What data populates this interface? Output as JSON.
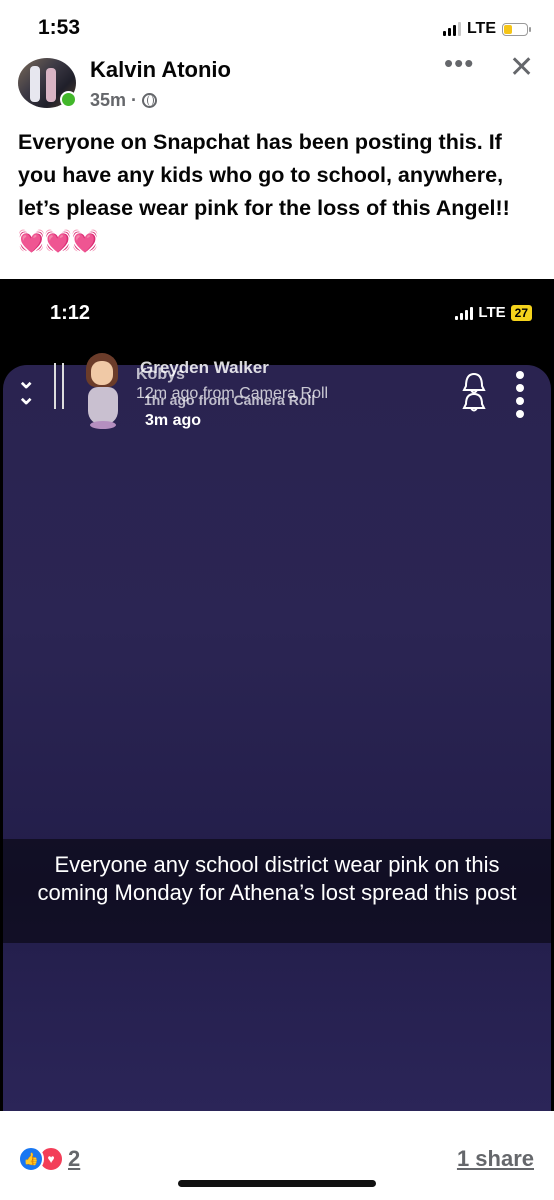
{
  "status_bar": {
    "time": "1:53",
    "network": "LTE",
    "battery_color": "#f5c518"
  },
  "post": {
    "author": "Kalvin Atonio",
    "time_ago": "35m",
    "separator": "·",
    "text": "Everyone on Snapchat has been posting this. If you have any kids who go to school, anywhere, let’s please wear pink for the loss of this Angel!! 💓💓💓",
    "more_icon": "more-horizontal-icon",
    "close_icon": "close-icon"
  },
  "shared_image": {
    "status_time": "1:12",
    "network": "LTE",
    "battery": "27",
    "user_overlap_a": "Greyden Walker",
    "user_overlap_b": "Kobys",
    "sub_overlap_a": "12m ago from Camera Roll",
    "sub_overlap_b": "1hr ago from Camera Roll",
    "time_ago": "3m ago",
    "caption": "Everyone any school district wear pink on this coming Monday for Athena’s lost spread this post"
  },
  "footer": {
    "reaction_count": "2",
    "shares": "1 share"
  }
}
